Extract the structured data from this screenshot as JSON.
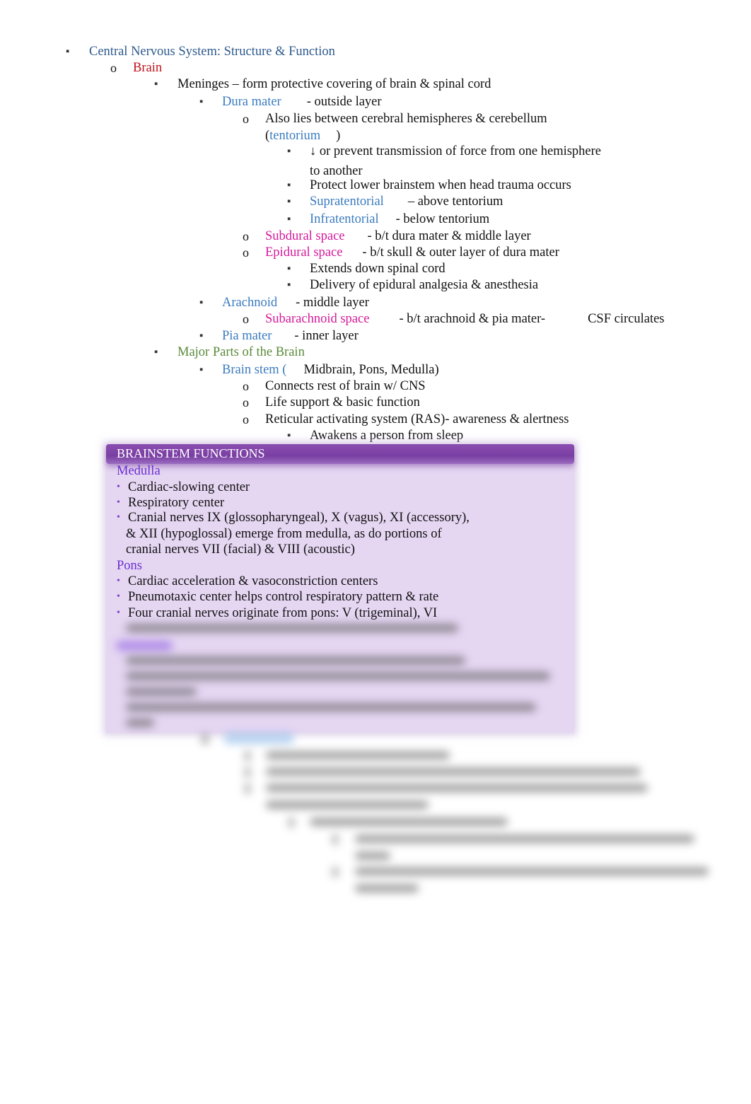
{
  "outline": [
    {
      "bullet": "▪",
      "label": "Central Nervous System: Structure & Function"
    },
    {
      "bullet": "o",
      "label": "Brain"
    },
    {
      "bullet": "▪",
      "label": "Meninges – form protective covering of brain & spinal cord"
    },
    {
      "bullet": "▪",
      "term": "Dura mater",
      "desc": "- outside layer"
    },
    {
      "bullet": "o",
      "text": "Also lies between cerebral hemispheres & cerebellum"
    },
    {
      "text_open": "(",
      "term": "tentorium",
      "text_close": ")"
    },
    {
      "bullet": "▪",
      "text": "↓ or prevent transmission of force from one hemisphere"
    },
    {
      "text": "to another"
    },
    {
      "bullet": "▪",
      "text": "Protect lower brainstem when head trauma occurs"
    },
    {
      "bullet": "▪",
      "term": "Supratentorial",
      "desc": "– above tentorium"
    },
    {
      "bullet": "▪",
      "term": "Infratentorial",
      "desc": "- below tentorium"
    },
    {
      "bullet": "o",
      "term": "Subdural space",
      "desc": "- b/t dura mater & middle layer"
    },
    {
      "bullet": "o",
      "term": "Epidural space",
      "desc": "- b/t skull & outer layer of dura mater"
    },
    {
      "bullet": "▪",
      "text": "Extends down spinal cord"
    },
    {
      "bullet": "▪",
      "text": "Delivery of epidural analgesia & anesthesia"
    },
    {
      "bullet": "▪",
      "term": "Arachnoid",
      "desc": "- middle layer"
    },
    {
      "bullet": "o",
      "term": "Subarachnoid space",
      "desc": "- b/t arachnoid & pia mater-",
      "desc2": "CSF circulates"
    },
    {
      "bullet": "▪",
      "term": "Pia mater",
      "desc": "- inner layer"
    },
    {
      "bullet": "▪",
      "label": "Major Parts of the Brain"
    },
    {
      "bullet": "▪",
      "term": "Brain stem (",
      "desc": "Midbrain, Pons, Medulla)"
    },
    {
      "bullet": "o",
      "text": "Connects rest of brain w/ CNS"
    },
    {
      "bullet": "o",
      "text": "Life support & basic function"
    },
    {
      "bullet": "o",
      "text": "Reticular activating system (RAS)- awareness & alertness"
    },
    {
      "bullet": "▪",
      "text": "Awakens a person from sleep"
    }
  ],
  "slide": {
    "title": "BRAINSTEM FUNCTIONS",
    "medulla_heading": "Medulla",
    "medulla_items": [
      "Cardiac-slowing center",
      "Respiratory center",
      "Cranial nerves IX (glossopharyngeal), X (vagus), XI (accessory),"
    ],
    "medulla_cont": [
      "& XII (hypoglossal) emerge from medulla, as do portions of",
      "cranial nerves VII (facial) & VIII (acoustic)"
    ],
    "pons_heading": "Pons",
    "pons_items": [
      "Cardiac acceleration & vasoconstriction centers",
      "Pneumotaxic center helps control respiratory pattern & rate",
      "Four cranial nerves originate from pons: V (trigeminal), VI"
    ],
    "bullet_glyph": "•",
    "colors": {
      "title_bar": "#7a3fa3",
      "background": "#e5d6f2",
      "heading": "#6a2fd0"
    }
  }
}
